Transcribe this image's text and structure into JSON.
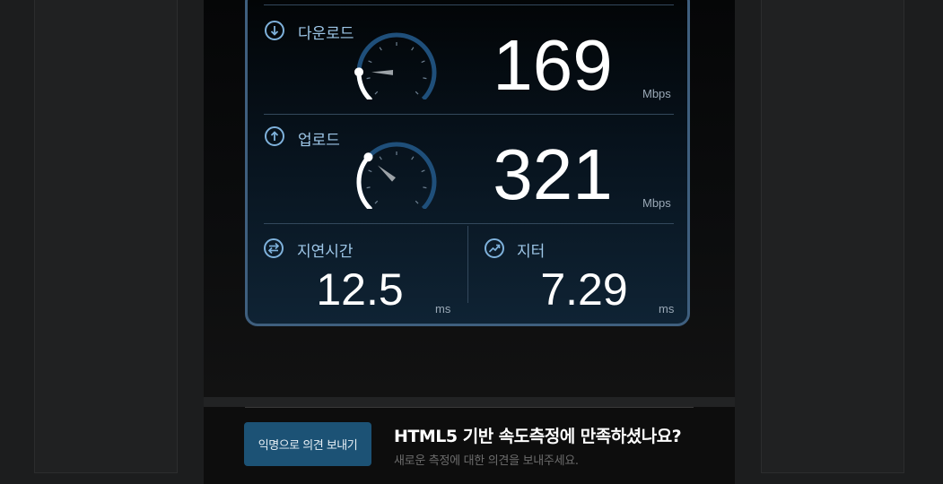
{
  "download": {
    "label": "다운로드",
    "value": "169",
    "unit": "Mbps",
    "gauge_fraction": 0.17
  },
  "upload": {
    "label": "업로드",
    "value": "321",
    "unit": "Mbps",
    "gauge_fraction": 0.32
  },
  "latency": {
    "label": "지연시간",
    "value": "12.5",
    "unit": "ms"
  },
  "jitter": {
    "label": "지터",
    "value": "7.29",
    "unit": "ms"
  },
  "feedback": {
    "button_label": "익명으로 의견 보내기",
    "title": "HTML5 기반 속도측정에 만족하셨나요?",
    "subtitle": "새로운 측정에 대한 의견을 보내주세요."
  },
  "colors": {
    "accent": "#7fb2dc",
    "card_border": "#3f5f7e",
    "button": "#1c5275",
    "gauge_track": "#1f4f7a"
  },
  "icons": {
    "download": "arrow-down-circle-icon",
    "upload": "arrow-up-circle-icon",
    "latency": "swap-arrows-icon",
    "jitter": "trend-line-icon"
  }
}
